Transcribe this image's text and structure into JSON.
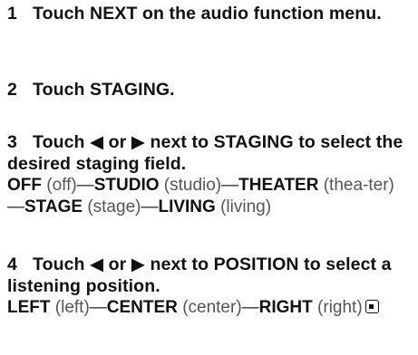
{
  "steps": [
    {
      "number": "1",
      "text": "Touch NEXT on the audio function menu."
    },
    {
      "number": "2",
      "text": "Touch STAGING."
    },
    {
      "number": "3",
      "text": "Touch ◀ or ▶ next to STAGING to select the desired staging field.",
      "options": [
        {
          "label": "OFF",
          "note": "(off)"
        },
        {
          "label": "STUDIO",
          "note": "(studio)"
        },
        {
          "label": "THEATER",
          "note": "(thea-ter)"
        },
        {
          "label": "STAGE",
          "note": "(stage)"
        },
        {
          "label": "LIVING",
          "note": "(living)"
        }
      ]
    },
    {
      "number": "4",
      "text": "Touch ◀ or ▶ next to POSITION to select a listening position.",
      "options": [
        {
          "label": "LEFT",
          "note": "(left)"
        },
        {
          "label": "CENTER",
          "note": "(center)"
        },
        {
          "label": "RIGHT",
          "note": "(right)"
        }
      ]
    }
  ],
  "separator": "—",
  "end_icon": "end-of-section-icon"
}
